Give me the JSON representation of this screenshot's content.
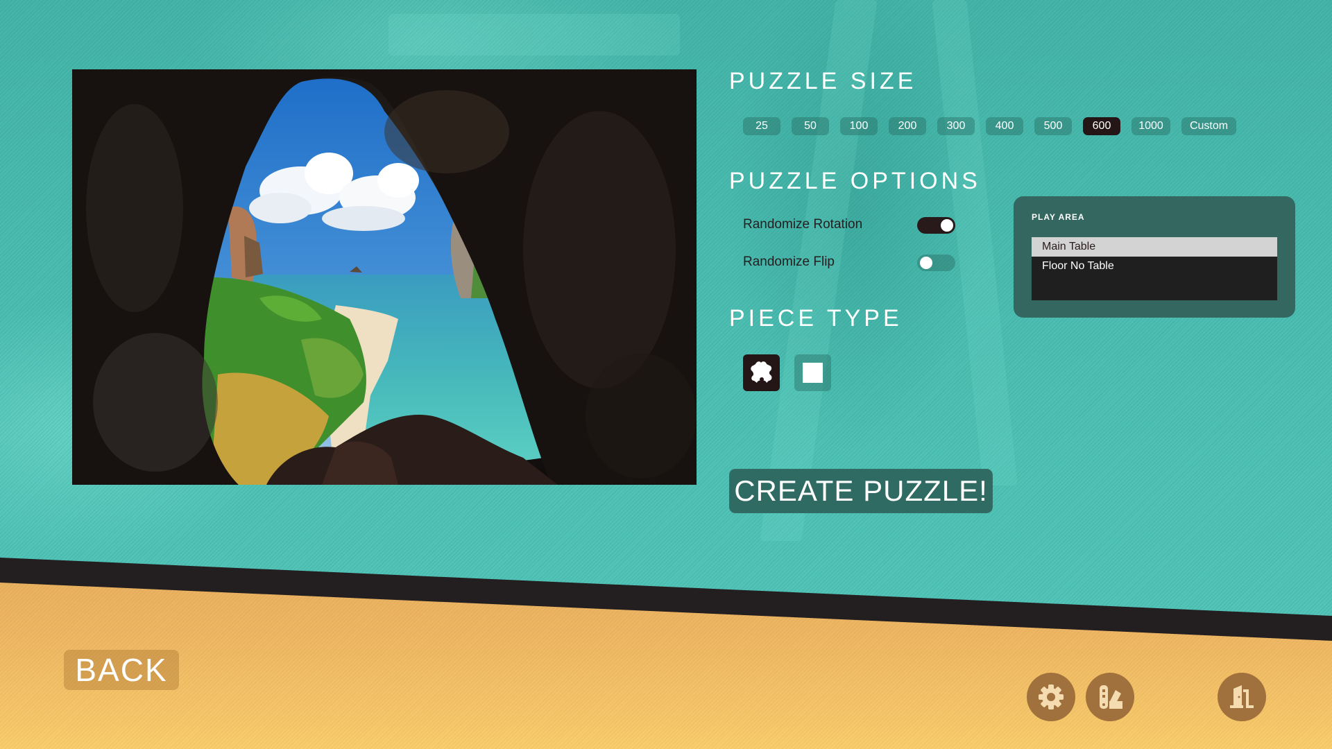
{
  "puzzle_size": {
    "title": "PUZZLE SIZE",
    "options": [
      "25",
      "50",
      "100",
      "200",
      "300",
      "400",
      "500",
      "600",
      "1000",
      "Custom"
    ],
    "selected": "600"
  },
  "puzzle_options": {
    "title": "PUZZLE OPTIONS",
    "items": [
      {
        "label": "Randomize Rotation",
        "enabled": true
      },
      {
        "label": "Randomize Flip",
        "enabled": false
      }
    ]
  },
  "piece_type": {
    "title": "PIECE TYPE",
    "options": [
      {
        "name": "jigsaw",
        "icon": "puzzle-piece-icon",
        "selected": true
      },
      {
        "name": "square",
        "icon": "square-icon",
        "selected": false
      }
    ]
  },
  "play_area": {
    "title": "PLAY AREA",
    "options": [
      "Main Table",
      "Floor No Table"
    ],
    "selected": "Main Table"
  },
  "actions": {
    "create_label": "CREATE PUZZLE!",
    "back_label": "BACK"
  },
  "footer_icons": [
    "gear-icon",
    "palette-icon",
    "exit-door-icon"
  ],
  "preview_image": {
    "description": "View from a cave opening onto a tropical beach with limestone cliffs, turquoise sea and cumulus clouds"
  },
  "colors": {
    "background_teal": "#4cbdb1",
    "selected_dark": "#241516",
    "band_dark": "#231e1f",
    "band_orange": "#d59c54",
    "panel": "#33675f"
  }
}
